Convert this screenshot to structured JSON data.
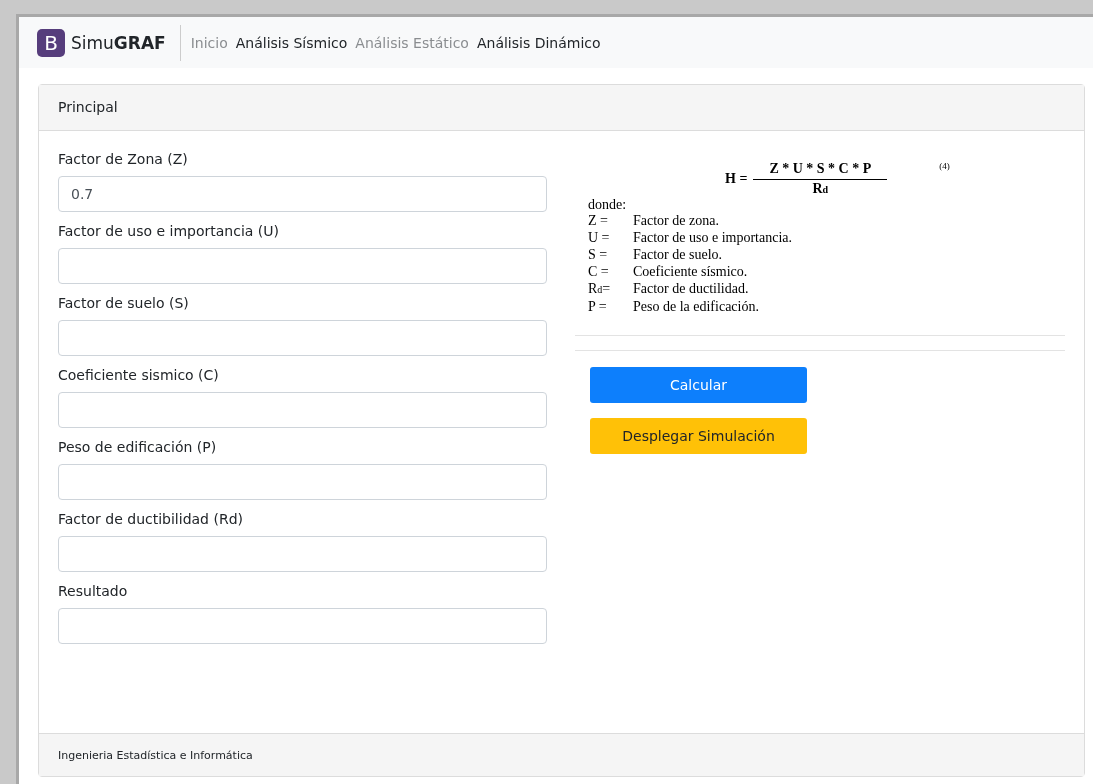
{
  "navbar": {
    "brand_letter": "B",
    "brand_light": "Simu",
    "brand_bold": "GRAF",
    "links": [
      {
        "label": "Inicio",
        "active": false
      },
      {
        "label": "Análisis Sísmico",
        "active": true
      },
      {
        "label": "Análisis Estático",
        "active": false
      },
      {
        "label": "Análisis Dinámico",
        "active": true
      }
    ]
  },
  "card": {
    "header": "Principal",
    "footer": "Ingenieria Estadística e Informática"
  },
  "fields": [
    {
      "label": "Factor de Zona (Z)",
      "value": "0.7"
    },
    {
      "label": "Factor de uso e importancia (U)"
    },
    {
      "label": "Factor de suelo (S)"
    },
    {
      "label": "Coeficiente sismico (C)"
    },
    {
      "label": "Peso de edificación (P)"
    },
    {
      "label": "Factor de ductibilidad (Rd)"
    },
    {
      "label": "Resultado"
    }
  ],
  "formula": {
    "lhs": "H",
    "eq": "=",
    "numerator": "Z * U * S * C * P",
    "denominator": "R$_{d}$",
    "number": "(4)",
    "intro": "donde:",
    "terms": [
      {
        "symbol": "Z =",
        "meaning": "Factor de zona."
      },
      {
        "symbol": "U =",
        "meaning": "Factor de uso e importancia."
      },
      {
        "symbol": "S =",
        "meaning": "Factor de suelo."
      },
      {
        "symbol": "C =",
        "meaning": "Coeficiente sísmico."
      },
      {
        "symbol": "R$_{d}$=",
        "meaning": "Factor de ductilidad."
      },
      {
        "symbol": "P =",
        "meaning": "Peso de la edificación."
      }
    ]
  },
  "buttons": [
    {
      "label": "Calcular",
      "kind": "primary"
    },
    {
      "label": "Desplegar Simulación",
      "kind": "warning"
    }
  ]
}
